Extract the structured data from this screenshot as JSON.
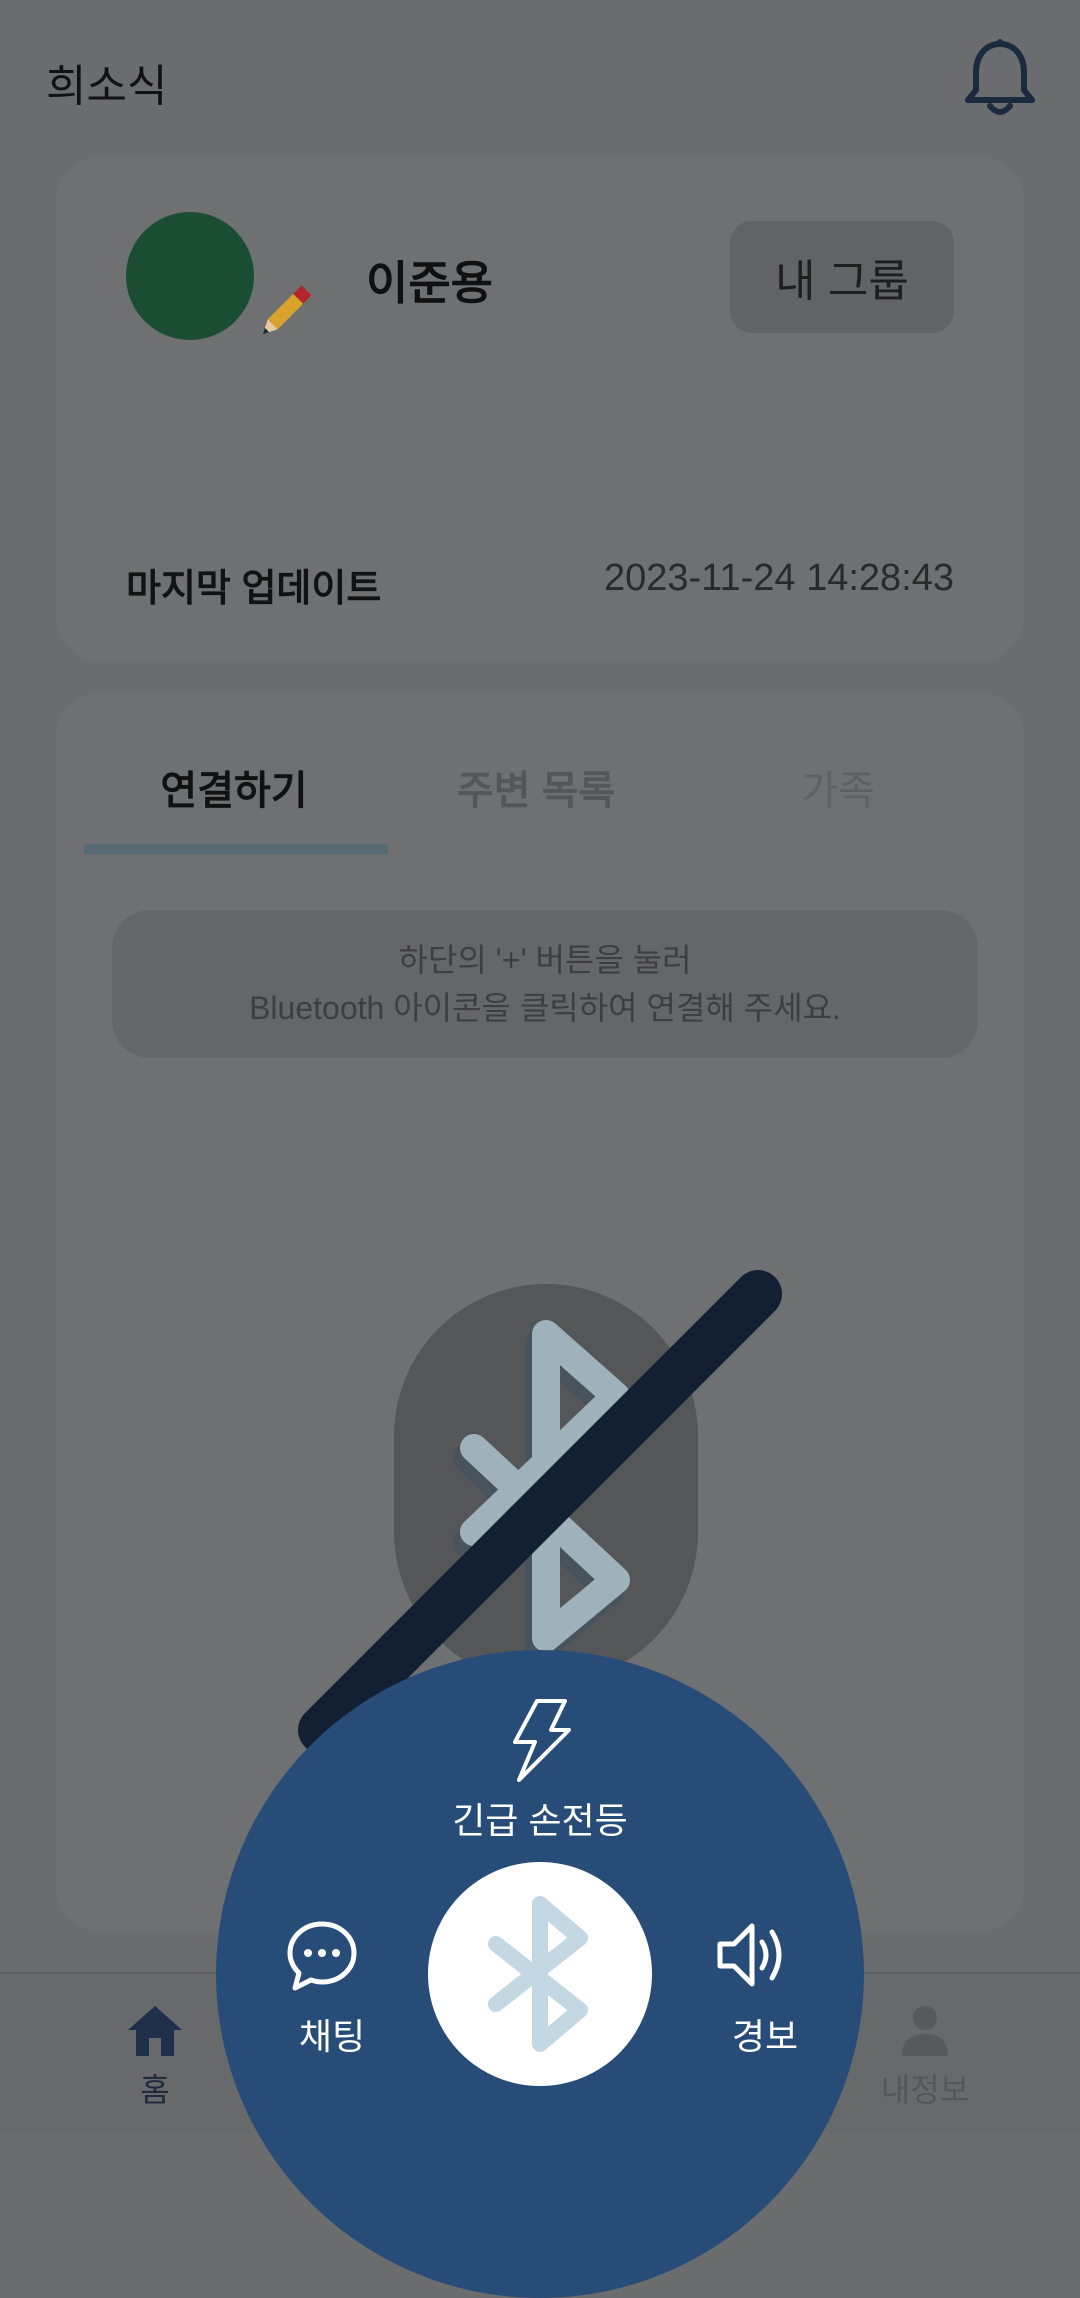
{
  "header": {
    "title": "희소식",
    "bell_icon": "bell-icon"
  },
  "profile": {
    "name": "이준용",
    "avatar_color": "#1b4d33",
    "edit_icon": "pencil-icon",
    "group_button": "내 그룹",
    "last_update_label": "마지막 업데이트",
    "last_update_value": "2023-11-24 14:28:43"
  },
  "tabs": [
    {
      "label": "연결하기",
      "active": true
    },
    {
      "label": "주변 목록",
      "active": false
    },
    {
      "label": "가족",
      "active": false
    }
  ],
  "hint": {
    "line1": "하단의 '+' 버튼을 눌러",
    "line2": "Bluetooth 아이콘을 클릭하여 연결해 주세요."
  },
  "fab_menu": {
    "flashlight_label": "긴급 손전등",
    "chat_label": "채팅",
    "alarm_label": "경보",
    "center_icon": "bluetooth-icon",
    "panel_color": "#274c78"
  },
  "bottom_nav": {
    "home_label": "홈",
    "profile_label": "내정보"
  }
}
